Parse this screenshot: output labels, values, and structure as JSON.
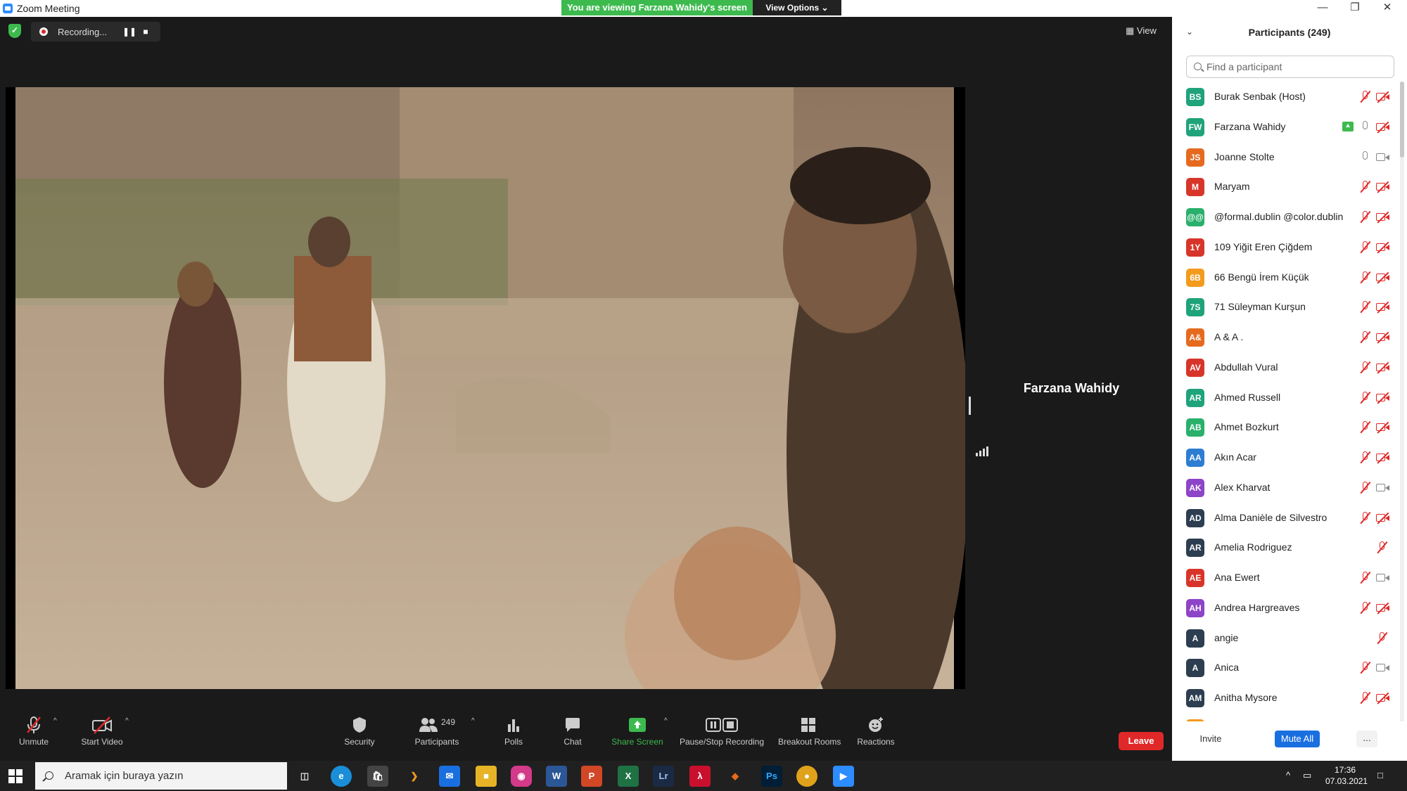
{
  "window": {
    "title": "Zoom Meeting"
  },
  "banner": {
    "text": "You are viewing Farzana Wahidy's screen",
    "view_options": "View Options"
  },
  "top": {
    "recording_label": "Recording...",
    "view_label": "View"
  },
  "video": {
    "speaker_name": "Farzana Wahidy"
  },
  "toolbar": {
    "unmute": "Unmute",
    "start_video": "Start Video",
    "security": "Security",
    "participants": "Participants",
    "participants_count": "249",
    "polls": "Polls",
    "chat": "Chat",
    "share_screen": "Share Screen",
    "recording": "Pause/Stop Recording",
    "breakout": "Breakout Rooms",
    "reactions": "Reactions",
    "leave": "Leave"
  },
  "panel": {
    "title": "Participants (249)",
    "search_placeholder": "Find a participant",
    "invite": "Invite",
    "mute_all": "Mute All",
    "more": "...",
    "participants": [
      {
        "initials": "BS",
        "name": "Burak Senbak (Host)",
        "color": "#1fa37a",
        "mic": "muted",
        "cam": "off"
      },
      {
        "initials": "FW",
        "name": "Farzana Wahidy",
        "color": "#1fa37a",
        "mic": "on",
        "cam": "off",
        "sharing": true
      },
      {
        "initials": "JS",
        "name": "Joanne Stolte",
        "color": "#e56a1e",
        "mic": "on",
        "cam": "on"
      },
      {
        "initials": "M",
        "name": "Maryam",
        "color": "#d8352a",
        "mic": "muted",
        "cam": "off"
      },
      {
        "initials": "@@",
        "name": "@formal.dublin @color.dublin",
        "color": "#29b06b",
        "mic": "muted",
        "cam": "off"
      },
      {
        "initials": "1Y",
        "name": "109 Yiğit Eren Çiğdem",
        "color": "#d8352a",
        "mic": "muted",
        "cam": "off"
      },
      {
        "initials": "6B",
        "name": "66 Bengü İrem Küçük",
        "color": "#f29b1d",
        "mic": "muted",
        "cam": "off"
      },
      {
        "initials": "7S",
        "name": "71 Süleyman Kurşun",
        "color": "#1fa37a",
        "mic": "muted",
        "cam": "off"
      },
      {
        "initials": "A&",
        "name": "A & A .",
        "color": "#e56a1e",
        "mic": "muted",
        "cam": "off"
      },
      {
        "initials": "AV",
        "name": "Abdullah Vural",
        "color": "#d8352a",
        "mic": "muted",
        "cam": "off"
      },
      {
        "initials": "AR",
        "name": "Ahmed Russell",
        "color": "#1fa37a",
        "mic": "muted",
        "cam": "off"
      },
      {
        "initials": "AB",
        "name": "Ahmet Bozkurt",
        "color": "#29b06b",
        "mic": "muted",
        "cam": "off"
      },
      {
        "initials": "AA",
        "name": "Akın Acar",
        "color": "#2d7dd2",
        "mic": "muted",
        "cam": "off"
      },
      {
        "initials": "AK",
        "name": "Alex Kharvat",
        "color": "#8e44c8",
        "mic": "muted",
        "cam": "on"
      },
      {
        "initials": "AD",
        "name": "Alma Danièle de Silvestro",
        "color": "#2c3e50",
        "mic": "muted",
        "cam": "off"
      },
      {
        "initials": "AR",
        "name": "Amelia Rodriguez",
        "color": "#2c3e50",
        "mic": "none",
        "cam": "muted-only"
      },
      {
        "initials": "AE",
        "name": "Ana Ewert",
        "color": "#d8352a",
        "mic": "muted",
        "cam": "on"
      },
      {
        "initials": "AH",
        "name": "Andrea Hargreaves",
        "color": "#8e44c8",
        "mic": "muted",
        "cam": "off"
      },
      {
        "initials": "A",
        "name": "angie",
        "color": "#2c3e50",
        "mic": "none",
        "cam": "muted-only"
      },
      {
        "initials": "A",
        "name": "Anica",
        "color": "#2c3e50",
        "mic": "muted",
        "cam": "on"
      },
      {
        "initials": "AM",
        "name": "Anitha Mysore",
        "color": "#2c3e50",
        "mic": "muted",
        "cam": "off"
      },
      {
        "initials": "",
        "name": "",
        "color": "#f29b1d",
        "mic": "muted",
        "cam": "none"
      }
    ]
  },
  "taskbar": {
    "search_placeholder": "Aramak için buraya yazın",
    "time": "17:36",
    "date": "07.03.2021"
  }
}
